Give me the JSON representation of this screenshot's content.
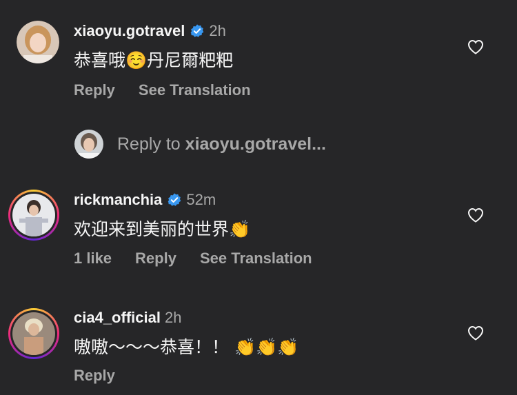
{
  "comments": [
    {
      "username": "xiaoyu.gotravel",
      "verified": true,
      "time": "2h",
      "text": "恭喜哦☺️丹尼爾粑粑",
      "likes": "",
      "reply_label": "Reply",
      "translate_label": "See Translation"
    },
    {
      "username": "rickmanchia",
      "verified": true,
      "time": "52m",
      "text": "欢迎来到美丽的世界👏",
      "likes": "1 like",
      "reply_label": "Reply",
      "translate_label": "See Translation"
    },
    {
      "username": "cia4_official",
      "verified": false,
      "time": "2h",
      "text": "嗷嗷～～～恭喜！！ 👏👏👏",
      "likes": "",
      "reply_label": "Reply",
      "translate_label": ""
    }
  ],
  "reply_prompt": {
    "prefix": "Reply to ",
    "target": "xiaoyu.gotravel..."
  },
  "colors": {
    "background": "#262628",
    "primary_text": "#f5f5f5",
    "secondary_text": "#a8a8a8",
    "verified_blue": "#3897f0"
  },
  "icons": {
    "like": "heart-outline-icon",
    "verified": "verified-badge-icon"
  }
}
